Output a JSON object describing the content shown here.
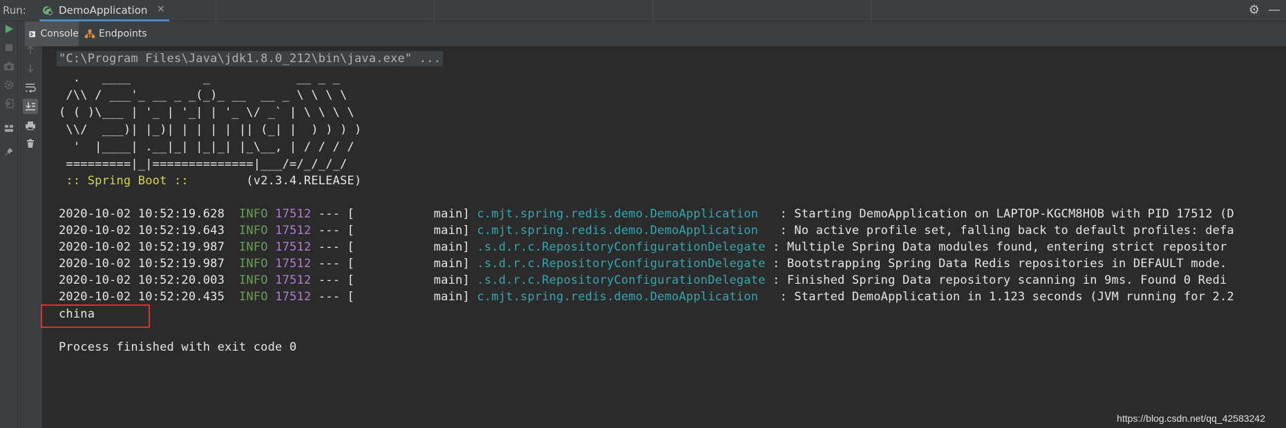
{
  "header": {
    "run_label": "Run:",
    "run_tab": "DemoApplication"
  },
  "tabs": [
    {
      "label": "Console",
      "icon": "console-icon",
      "active": true
    },
    {
      "label": "Endpoints",
      "icon": "endpoints-icon",
      "active": false
    }
  ],
  "console": {
    "command": "\"C:\\Program Files\\Java\\jdk1.8.0_212\\bin\\java.exe\" ...",
    "banner": [
      "  .   ____          _            __ _ _",
      " /\\\\ / ___'_ __ _ _(_)_ __  __ _ \\ \\ \\ \\",
      "( ( )\\___ | '_ | '_| | '_ \\/ _` | \\ \\ \\ \\",
      " \\\\/  ___)| |_)| | | | | || (_| |  ) ) ) )",
      "  '  |____| .__|_| |_|_| |_\\__, | / / / /",
      " =========|_|==============|___/=/_/_/_/"
    ],
    "spring_label": " :: Spring Boot :: ",
    "spring_version": "       (v2.3.4.RELEASE)",
    "logs": [
      {
        "time": "2020-10-02 10:52:19.628",
        "level": "INFO",
        "pid": "17512",
        "thread": "--- [           main]",
        "logger": "c.mjt.spring.redis.demo.DemoApplication  ",
        "message": ": Starting DemoApplication on LAPTOP-KGCM8HOB with PID 17512 (D"
      },
      {
        "time": "2020-10-02 10:52:19.643",
        "level": "INFO",
        "pid": "17512",
        "thread": "--- [           main]",
        "logger": "c.mjt.spring.redis.demo.DemoApplication  ",
        "message": ": No active profile set, falling back to default profiles: defa"
      },
      {
        "time": "2020-10-02 10:52:19.987",
        "level": "INFO",
        "pid": "17512",
        "thread": "--- [           main]",
        "logger": ".s.d.r.c.RepositoryConfigurationDelegate",
        "message": " : Multiple Spring Data modules found, entering strict repositor"
      },
      {
        "time": "2020-10-02 10:52:19.987",
        "level": "INFO",
        "pid": "17512",
        "thread": "--- [           main]",
        "logger": ".s.d.r.c.RepositoryConfigurationDelegate",
        "message": " : Bootstrapping Spring Data Redis repositories in DEFAULT mode."
      },
      {
        "time": "2020-10-02 10:52:20.003",
        "level": "INFO",
        "pid": "17512",
        "thread": "--- [           main]",
        "logger": ".s.d.r.c.RepositoryConfigurationDelegate",
        "message": " : Finished Spring Data repository scanning in 9ms. Found 0 Redi"
      },
      {
        "time": "2020-10-02 10:52:20.435",
        "level": "INFO",
        "pid": "17512",
        "thread": "--- [           main]",
        "logger": "c.mjt.spring.redis.demo.DemoApplication  ",
        "message": ": Started DemoApplication in 1.123 seconds (JVM running for 2.2"
      }
    ],
    "output": "china",
    "exit_message": "Process finished with exit code 0"
  },
  "watermark": "https://blog.csdn.net/qq_42583242",
  "colors": {
    "accent": "#4a88c7",
    "info": "#6a9e5a",
    "pid": "#b07bd1",
    "logger": "#34a6b0",
    "spring": "#d8d84a",
    "highlight": "#e03030"
  }
}
